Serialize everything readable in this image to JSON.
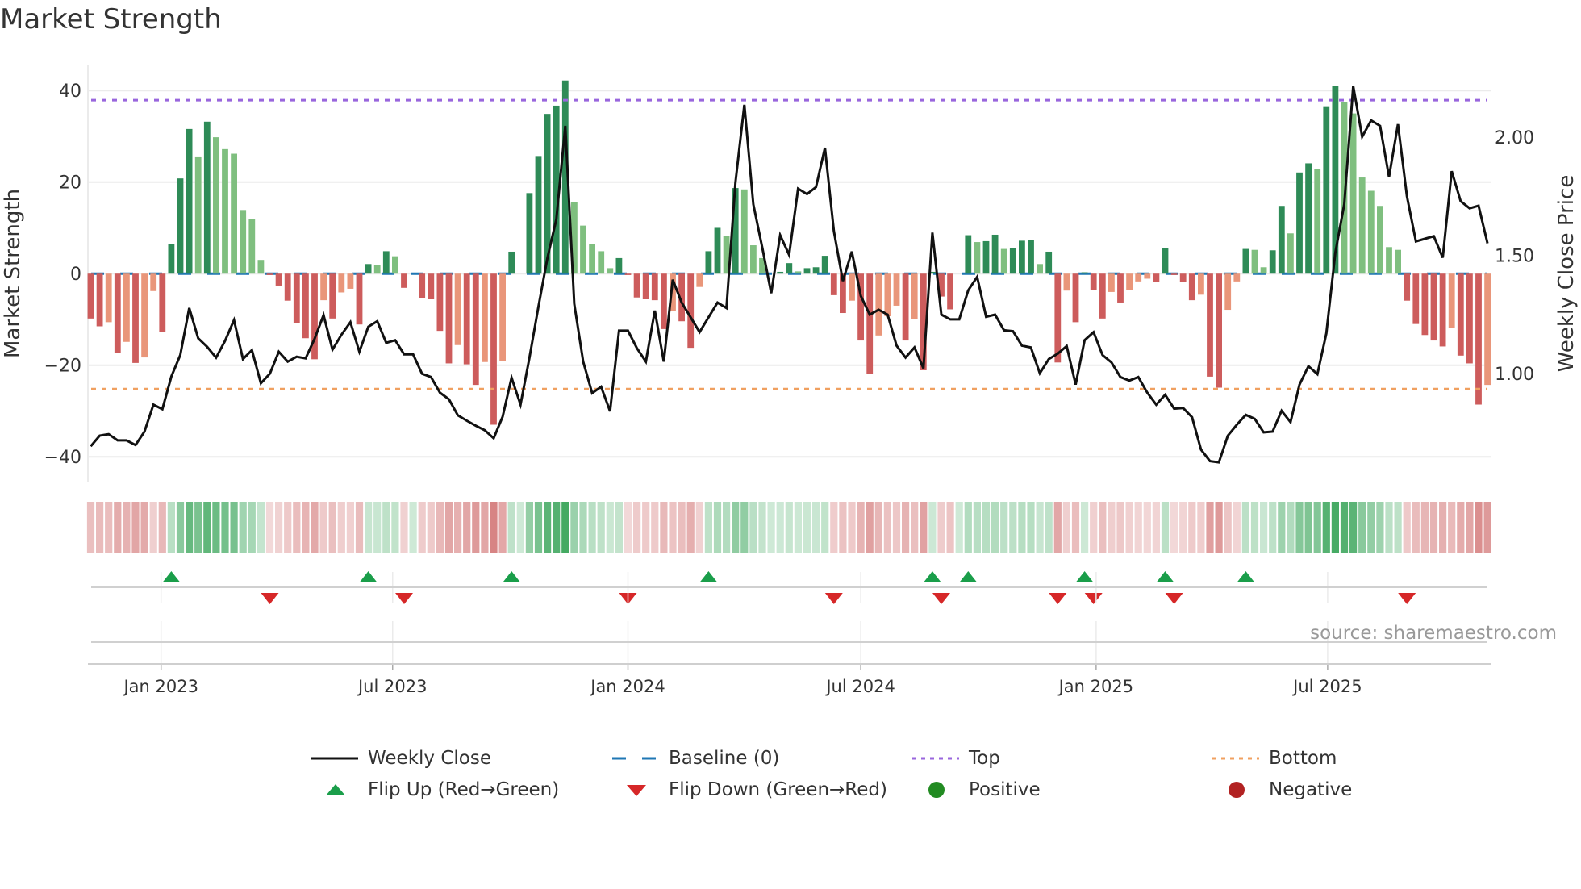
{
  "title": "Market Strength",
  "source": "source: sharemaestro.com",
  "colors": {
    "pos_strong": "#2e8b57",
    "pos_weak": "#7fbf7f",
    "neg_strong": "#cd5c5c",
    "neg_weak": "#e9967a",
    "baseline": "#1f77b4",
    "top": "#9966dd",
    "bottom": "#f0a060",
    "price": "#111111",
    "flip_up": "#1a9e4a",
    "flip_down": "#d62728",
    "positive": "#228b22",
    "negative": "#b22222",
    "heat_pos": "#3aa55a",
    "heat_neg": "#cd6565",
    "grid": "#ebebeb"
  },
  "legend": [
    {
      "label": "Weekly Close",
      "icon": "solid-line"
    },
    {
      "label": "Baseline (0)",
      "icon": "dashed-line"
    },
    {
      "label": "Top",
      "icon": "dotted-line-purple"
    },
    {
      "label": "Bottom",
      "icon": "dotted-line-orange"
    },
    {
      "label": "Flip Up (Red→Green)",
      "icon": "triangle-up"
    },
    {
      "label": "Flip Down (Green→Red)",
      "icon": "triangle-down"
    },
    {
      "label": "Positive",
      "icon": "circle-green"
    },
    {
      "label": "Negative",
      "icon": "circle-red"
    }
  ],
  "chart_data": {
    "type": "bar",
    "title": "Market Strength",
    "ylabel": "Market Strength",
    "y2label": "Weekly Close Price",
    "ylim": [
      -45.6,
      45.5
    ],
    "y2lim": [
      0.539,
      2.304
    ],
    "yticks": [
      {
        "v": 40,
        "label": "40"
      },
      {
        "v": 20,
        "label": "20"
      },
      {
        "v": 0,
        "label": "0"
      },
      {
        "v": -20,
        "label": "−20"
      },
      {
        "v": -40,
        "label": "−40"
      }
    ],
    "y2ticks": [
      {
        "v": 2.0,
        "label": "2.00"
      },
      {
        "v": 1.5,
        "label": "1.50"
      },
      {
        "v": 1.0,
        "label": "1.00"
      }
    ],
    "x_start": "2022-11-07",
    "x_step_days": 7,
    "xticks": [
      {
        "label": "Jan 2023",
        "date": "2023-01-01"
      },
      {
        "label": "Jul 2023",
        "date": "2023-07-01"
      },
      {
        "label": "Jan 2024",
        "date": "2024-01-01"
      },
      {
        "label": "Jul 2024",
        "date": "2024-07-01"
      },
      {
        "label": "Jan 2025",
        "date": "2025-01-01"
      },
      {
        "label": "Jul 2025",
        "date": "2025-07-01"
      }
    ],
    "top_level": 37.9,
    "bottom_level": -25.2,
    "grid": true,
    "legend_position": "bottom",
    "strength": [
      -9.8,
      -11.5,
      -10.6,
      -17.4,
      -14.9,
      -19.5,
      -18.3,
      -3.8,
      -12.7,
      6.5,
      20.8,
      31.6,
      25.6,
      33.2,
      29.8,
      27.2,
      26.2,
      13.9,
      12.0,
      3.0,
      -0.3,
      -2.6,
      -5.9,
      -10.8,
      -14.1,
      -18.7,
      -5.8,
      -9.8,
      -4.1,
      -3.3,
      -11.1,
      2.1,
      1.9,
      4.9,
      3.8,
      -3.1,
      0,
      -5.4,
      -5.6,
      -12.5,
      -19.6,
      -15.6,
      -19.8,
      -24.3,
      -19.3,
      -33.0,
      -19.1,
      4.8,
      0,
      17.6,
      25.7,
      34.9,
      36.7,
      42.2,
      15.7,
      10.5,
      6.5,
      4.9,
      1.2,
      3.4,
      -0.3,
      -5.2,
      -5.6,
      -5.8,
      -12.1,
      -8.2,
      -10.4,
      -16.2,
      -2.9,
      4.9,
      10.0,
      8.3,
      18.7,
      18.4,
      6.2,
      3.4,
      0,
      0.4,
      2.3,
      0.5,
      1.2,
      1.4,
      3.9,
      -4.7,
      -8.6,
      -5.9,
      -14.6,
      -21.9,
      -13.5,
      -9.3,
      -7.0,
      -14.6,
      -9.9,
      -21.1,
      0.4,
      -5.0,
      -7.8,
      0,
      8.4,
      6.9,
      7.1,
      8.5,
      5.4,
      5.5,
      7.2,
      7.3,
      2.1,
      4.8,
      -19.4,
      -3.7,
      -10.6,
      0.3,
      -3.5,
      -9.8,
      -4.0,
      -6.3,
      -3.5,
      -1.7,
      -1.1,
      -1.8,
      5.6,
      -0.3,
      -1.8,
      -5.8,
      -4.6,
      -22.5,
      -24.9,
      -7.9,
      -1.7,
      5.4,
      5.2,
      1.4,
      5.1,
      14.8,
      8.8,
      22.1,
      24.1,
      22.9,
      36.4,
      41.0,
      37.4,
      35.0,
      21.0,
      18.1,
      14.8,
      5.8,
      5.2,
      -5.9,
      -11.0,
      -13.4,
      -14.6,
      -15.9,
      -11.9,
      -17.9,
      -19.6,
      -28.6,
      -24.3
    ],
    "weekly_close": [
      0.692,
      0.737,
      0.743,
      0.717,
      0.717,
      0.697,
      0.754,
      0.868,
      0.849,
      0.987,
      1.078,
      1.277,
      1.149,
      1.113,
      1.067,
      1.138,
      1.226,
      1.061,
      1.099,
      0.959,
      0.999,
      1.092,
      1.05,
      1.071,
      1.064,
      1.147,
      1.247,
      1.101,
      1.164,
      1.217,
      1.092,
      1.198,
      1.221,
      1.13,
      1.141,
      1.081,
      1.081,
      0.999,
      0.985,
      0.919,
      0.891,
      0.823,
      0.8,
      0.779,
      0.76,
      0.726,
      0.817,
      0.982,
      0.868,
      1.067,
      1.283,
      1.488,
      1.653,
      2.048,
      1.295,
      1.05,
      0.917,
      0.944,
      0.84,
      1.181,
      1.181,
      1.107,
      1.05,
      1.266,
      1.05,
      1.397,
      1.3,
      1.238,
      1.175,
      1.238,
      1.3,
      1.277,
      1.807,
      2.137,
      1.716,
      1.533,
      1.34,
      1.585,
      1.502,
      1.782,
      1.759,
      1.789,
      1.955,
      1.602,
      1.391,
      1.516,
      1.329,
      1.249,
      1.27,
      1.249,
      1.118,
      1.067,
      1.11,
      1.022,
      1.596,
      1.249,
      1.229,
      1.229,
      1.352,
      1.409,
      1.24,
      1.249,
      1.183,
      1.179,
      1.118,
      1.11,
      1.001,
      1.061,
      1.084,
      1.116,
      0.953,
      1.141,
      1.175,
      1.078,
      1.047,
      0.985,
      0.97,
      0.985,
      0.919,
      0.868,
      0.91,
      0.851,
      0.854,
      0.815,
      0.678,
      0.629,
      0.624,
      0.737,
      0.783,
      0.825,
      0.808,
      0.751,
      0.754,
      0.842,
      0.794,
      0.953,
      1.031,
      0.997,
      1.17,
      1.511,
      1.716,
      2.216,
      2.002,
      2.071,
      2.048,
      1.832,
      2.055,
      1.75,
      1.559,
      1.57,
      1.581,
      1.49,
      1.856,
      1.729,
      1.699,
      1.71,
      1.551
    ],
    "flip_up_index": [
      9,
      31,
      47,
      69,
      94,
      98,
      111,
      120,
      129
    ],
    "flip_down_index": [
      20,
      35,
      60,
      83,
      95,
      108,
      112,
      121,
      147
    ]
  }
}
